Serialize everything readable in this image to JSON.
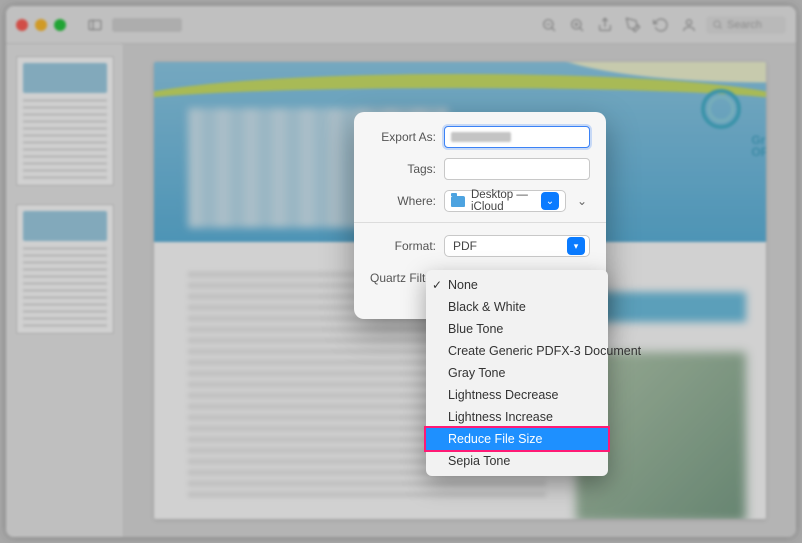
{
  "toolbar": {
    "search_placeholder": "Search"
  },
  "doc": {
    "logo_text_1": "Gr",
    "logo_text_2": "OF"
  },
  "sheet": {
    "export_as_label": "Export As:",
    "tags_label": "Tags:",
    "where_label": "Where:",
    "where_value": "Desktop — iCloud",
    "format_label": "Format:",
    "format_value": "PDF",
    "quartz_label": "Quartz Filter"
  },
  "menu": {
    "items": [
      "None",
      "Black & White",
      "Blue Tone",
      "Create Generic PDFX-3 Document",
      "Gray Tone",
      "Lightness Decrease",
      "Lightness Increase",
      "Reduce File Size",
      "Sepia Tone"
    ],
    "selected_index": 0,
    "highlight_index": 7
  }
}
